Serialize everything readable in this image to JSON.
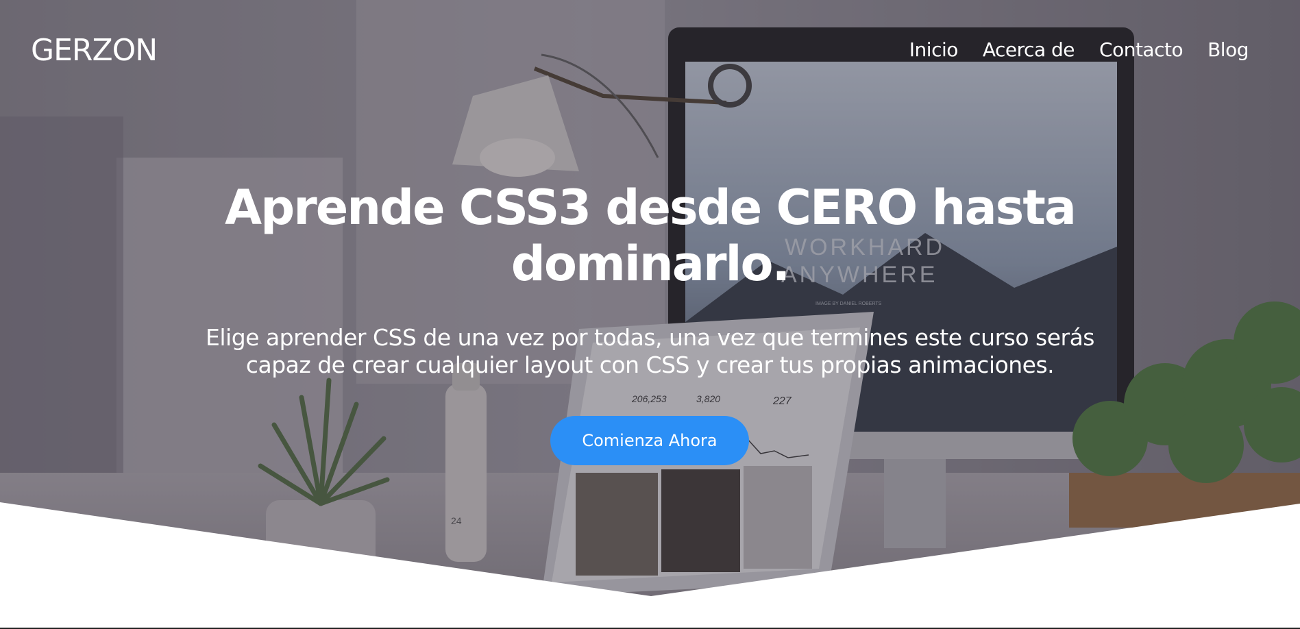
{
  "header": {
    "brand": "GERZON",
    "nav": [
      "Inicio",
      "Acerca de",
      "Contacto",
      "Blog"
    ]
  },
  "hero": {
    "title_line1": "Aprende CSS3 desde CERO hasta",
    "title_line2": "dominarlo.",
    "subtitle_line1": "Elige aprender CSS de una vez por todas, una vez que termines este curso serás",
    "subtitle_line2": "capaz de crear cualquier layout con CSS y crear tus propias animaciones.",
    "cta_label": "Comienza Ahora",
    "photo_text": {
      "screen_headline_1": "WORKHARD",
      "screen_headline_2": "ANYWHERE",
      "screen_credit": "IMAGE BY DANIEL ROBERTS",
      "stat_1": "206,253",
      "stat_2": "3,820",
      "stat_3": "227",
      "bottle_number": "24"
    }
  },
  "colors": {
    "accent": "#2b8ff6",
    "text": "#ffffff",
    "overlay": "#4a4550"
  }
}
